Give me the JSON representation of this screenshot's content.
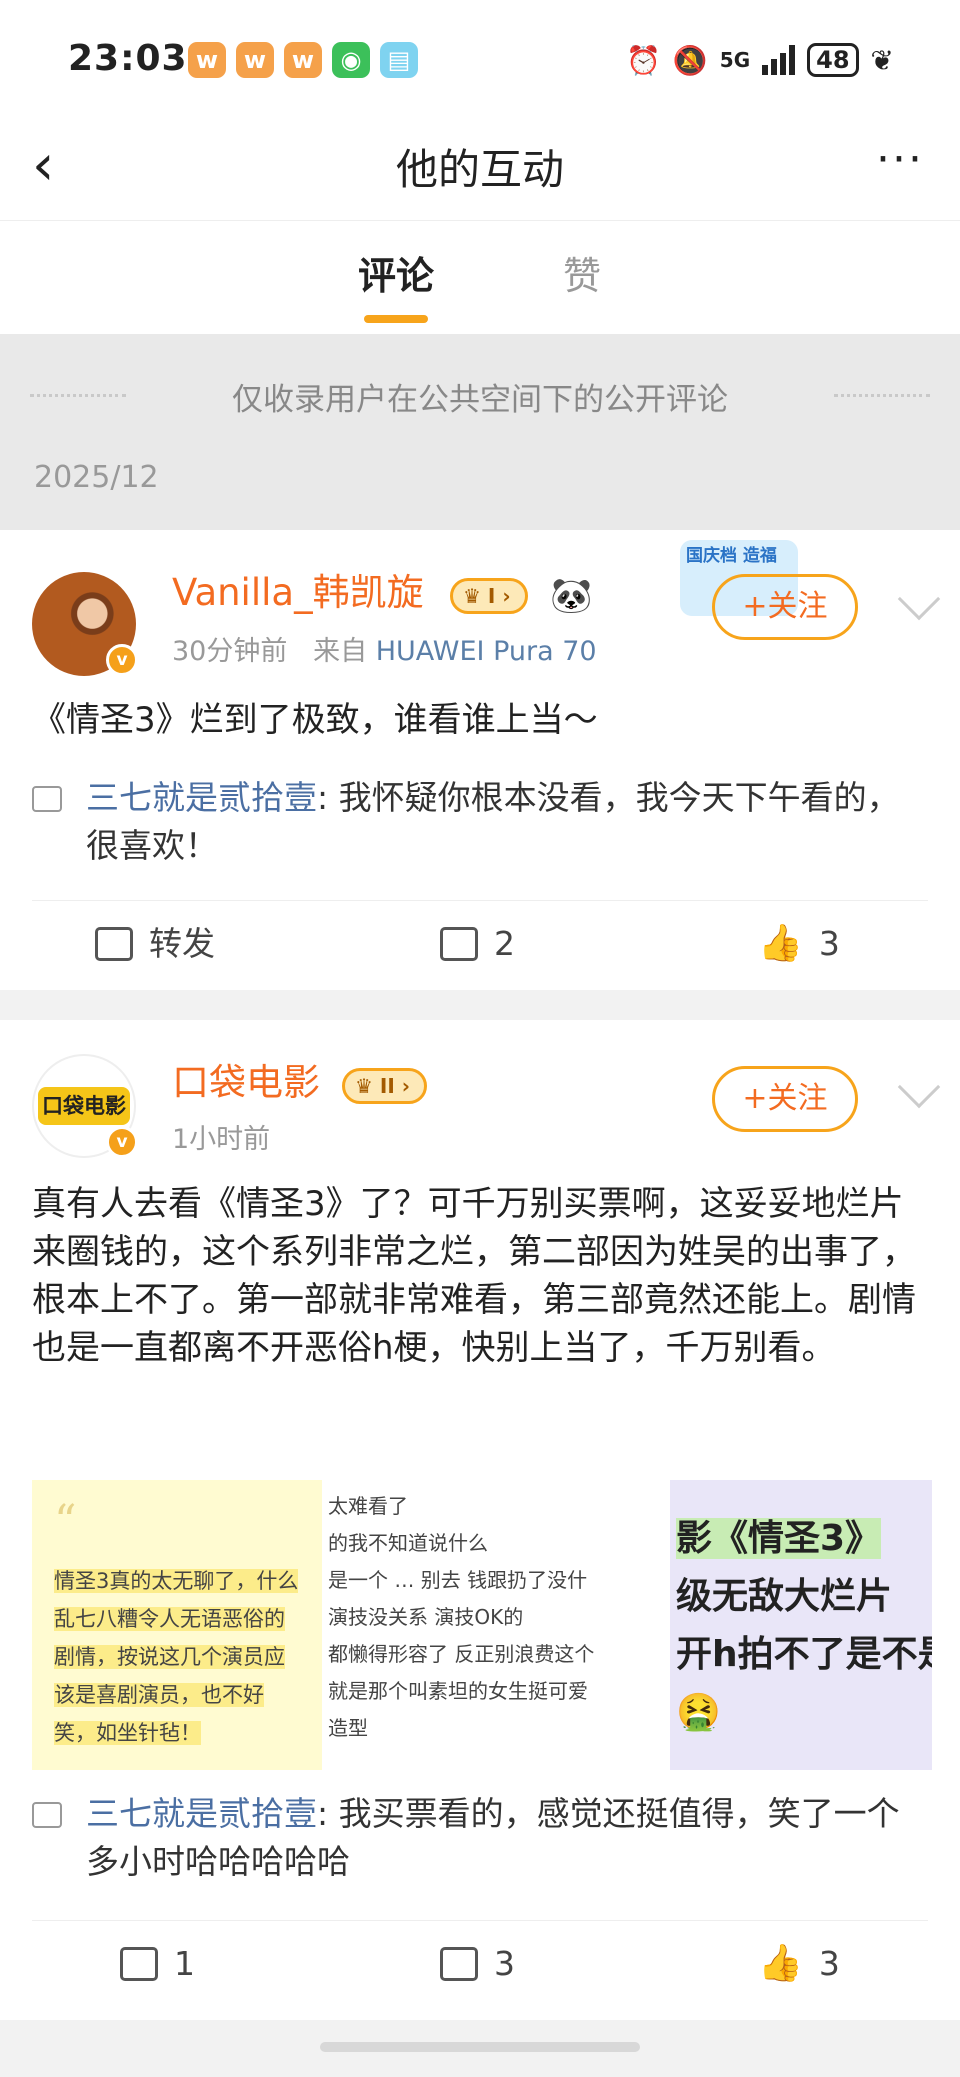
{
  "status_bar": {
    "time": "23:03",
    "notification_icons": [
      "weibo-icon",
      "weibo-icon",
      "weibo-icon",
      "wechat-icon",
      "book-icon"
    ],
    "signal": "5G",
    "battery": "48"
  },
  "nav": {
    "title": "他的互动",
    "back_label": "‹",
    "more_label": "···"
  },
  "tabs": [
    {
      "label": "评论"
    },
    {
      "label": "赞"
    }
  ],
  "notice": {
    "text": "仅收录用户在公共空间下的公开评论",
    "date": "2025/12"
  },
  "posts": [
    {
      "user": "Vanilla_韩凯旋",
      "level": "I",
      "emoji": "🐼",
      "verified_badge": "v",
      "time": "30分钟前",
      "source_prefix": "来自",
      "device": "HUAWEI Pura 70",
      "follow_label": "+关注",
      "promo_text": "国庆档 造福",
      "text": "《情圣3》烂到了极致，谁看谁上当～",
      "reply": {
        "user": "三七就是贰拾壹",
        "text": ": 我怀疑你根本没看，我今天下午看的，很喜欢！"
      },
      "actions": {
        "forward": "转发",
        "comments": "2",
        "likes": "3"
      }
    },
    {
      "user": "口袋电影",
      "level": "II",
      "avatar_text": "口袋电影",
      "verified_badge": "v",
      "time": "1小时前",
      "follow_label": "+关注",
      "text": "真有人去看《情圣3》了？可千万别买票啊，这妥妥地烂片来圈钱的，这个系列非常之烂，第二部因为姓吴的出事了，根本上不了。第一部就非常难看，第三部竟然还能上。剧情也是一直都离不开恶俗h梗，快别上当了，千万别看。",
      "images": {
        "img1_quote": "“",
        "img1_text": "情圣3真的太无聊了，什么乱七八糟令人无语恶俗的剧情，按说这几个演员应该是喜剧演员，也不好笑，如坐针毡！",
        "img2_lines": [
          "太难看了",
          "的我不知道说什么",
          "是一个 … 别去 钱跟扔了没什",
          "演技没关系 演技OK的",
          "都懒得形容了 反正别浪费这个",
          "就是那个叫素坦的女生挺可爱",
          "造型"
        ],
        "img3_lines": [
          "影《情圣3》",
          "级无敌大烂片",
          "开h拍不了是不是",
          "🤮"
        ]
      },
      "reply": {
        "user": "三七就是贰拾壹",
        "text": ": 我买票看的，感觉还挺值得，笑了一个多小时哈哈哈哈哈"
      },
      "actions": {
        "forward": "1",
        "comments": "3",
        "likes": "3"
      }
    }
  ],
  "colors": {
    "accent": "#f7a41b",
    "username": "#f36b21",
    "reply_name": "#4b6fa3"
  }
}
